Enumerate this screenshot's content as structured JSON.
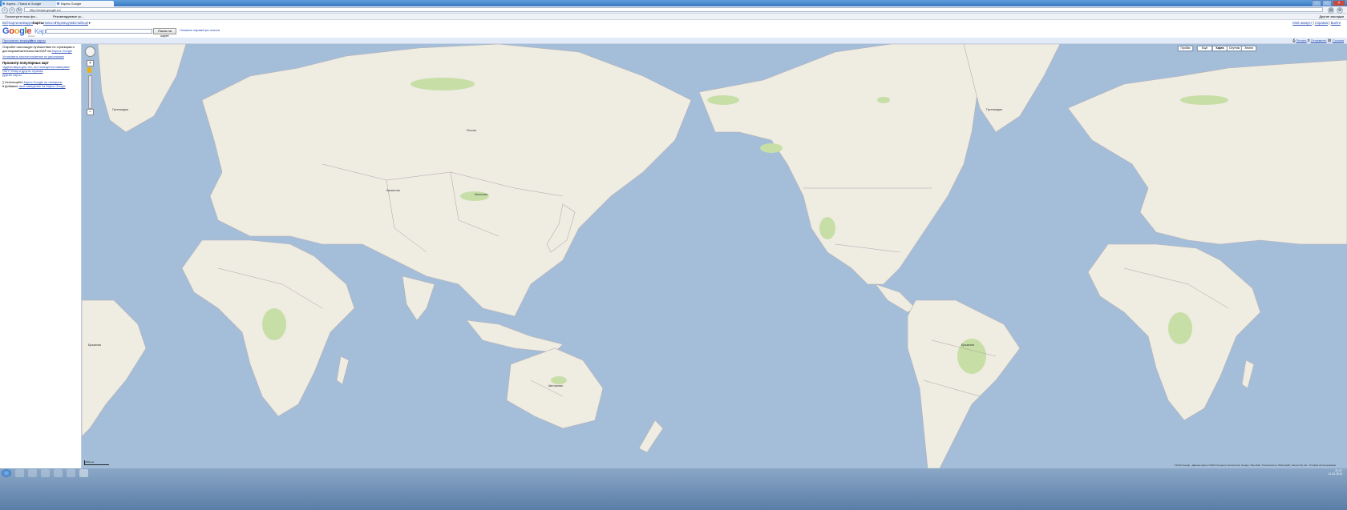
{
  "browser": {
    "tabs": [
      {
        "label": "Карты - Поиск в Google"
      },
      {
        "label": "Карты Google"
      }
    ],
    "url": "http://maps.google.ru/",
    "bookmarks": [
      "Посмотрите ваш фа...",
      "Рекомендуемые ус..."
    ],
    "bookmarks_right": "Другие закладки"
  },
  "google_bar": {
    "links": [
      "Веб",
      "Картинки",
      "Видео",
      "Карты",
      "Новости",
      "Переводчик",
      "Gmail",
      "ещё"
    ],
    "current": "Карты",
    "right_links": [
      "Мой аккаунт",
      "Справка",
      "Выйти"
    ]
  },
  "header": {
    "logo_google": "Google",
    "logo_maps": "Карты",
    "logo_sub": "Россия",
    "search_button": "Поиск на карте",
    "search_options": "Показать параметры поиска"
  },
  "strip": {
    "left_links": [
      "Проложить маршрут",
      "Мои карты"
    ],
    "right_links": [
      "Печать",
      "Отправить",
      "Ссылка"
    ]
  },
  "sidebar": {
    "intro": "Откройте настоящую путешествие по страницам и достопримечательностям ЮАР на",
    "intro_link": "Картах Google",
    "set_location": "Установить местоположение по умолчанию",
    "popular_heading": "Просмотр популярных карт",
    "popular_link1": "Чудеса мира для тех, кто пользуется камерами",
    "popular_link2": "ЯКП+YMap и других странах",
    "more_maps": "Другие карты",
    "mobile_prefix": "Используйте",
    "mobile_link": "Карты Google на телефоне",
    "add_prefix": "Добавьте",
    "add_link": "свое заведение на Карты Google"
  },
  "map": {
    "map_types": [
      "Пробки",
      "Ещё",
      "Карта",
      "Спутник",
      "Земля"
    ],
    "active_type": "Карта",
    "labels": {
      "russia": "Россия",
      "kazakhstan": "Казахстан",
      "mongolia": "Монголия",
      "australia": "Австралия",
      "brazil": "Бразилия",
      "greenland1": "Гренландия",
      "greenland2": "Гренландия",
      "brazil2": "Бразилия"
    },
    "scale": "2000 км",
    "copyright": "©2010 Google - Данные карты ©2010 Геоцентр Консалтинг, Google, Tele Atlas, Transnavicom, Whereis(R), Sensis Pty Ltd - Условия использования"
  },
  "taskbar": {
    "time": "22:37",
    "date": "11.04.2010"
  },
  "colors": {
    "water": "#a4bed9",
    "land": "#efece2",
    "forest": "#c7dfa6",
    "border": "#9a8f9e"
  }
}
